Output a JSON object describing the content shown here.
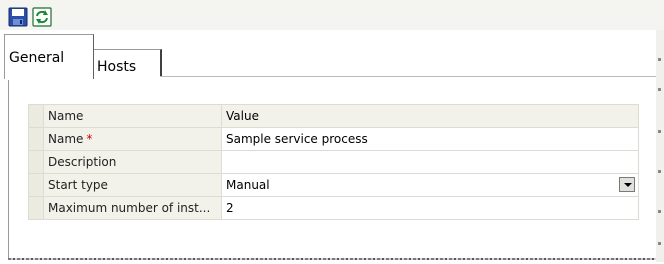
{
  "toolbar": {
    "save_icon": "floppy-disk-icon",
    "refresh_icon": "refresh-icon"
  },
  "tabs": [
    {
      "label": "General",
      "active": true
    },
    {
      "label": "Hosts",
      "active": false
    }
  ],
  "grid": {
    "headers": {
      "name": "Name",
      "value": "Value"
    },
    "rows": [
      {
        "name": "Name",
        "required_mark": "*",
        "value": "Sample service process"
      },
      {
        "name": "Description",
        "value": ""
      },
      {
        "name": "Start type",
        "value": "Manual"
      },
      {
        "name": "Maximum number of inst...",
        "value": "2"
      }
    ]
  },
  "colors": {
    "toolbar_bg": "#f4f4f0",
    "gutter": "#ecebe0",
    "header_bg": "#f3f2ea",
    "required": "#d00000"
  }
}
